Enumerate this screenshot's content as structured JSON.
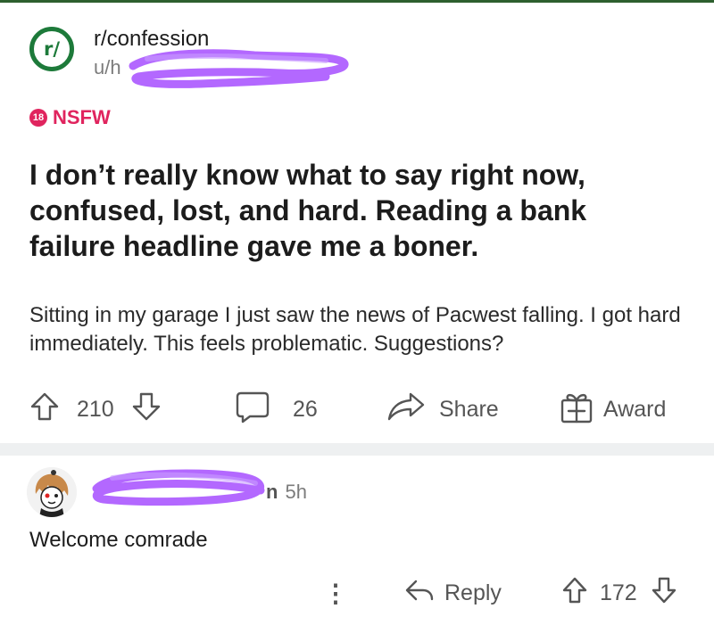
{
  "post": {
    "subreddit": "r/confession",
    "subreddit_icon_text": "r/",
    "user_prefix": "u/",
    "nsfw_badge": "18",
    "nsfw_label": "NSFW",
    "title": "I don’t really know what to say right now, confused, lost, and hard. Reading a bank failure headline gave me a boner.",
    "body": "Sitting in my garage I just saw the news of Pacwest falling. I got hard immediately. This feels problematic. Suggestions?",
    "upvotes": "210",
    "comments": "26",
    "share_label": "Share",
    "award_label": "Award"
  },
  "comment": {
    "author_visible_fragment": "n",
    "age": "5h",
    "text": "Welcome comrade",
    "more_icon": "⋮",
    "reply_label": "Reply",
    "upvotes": "172"
  },
  "colors": {
    "accent_green": "#1d7a3a",
    "nsfw_red": "#e0245e",
    "redaction_purple": "#a64dff"
  }
}
